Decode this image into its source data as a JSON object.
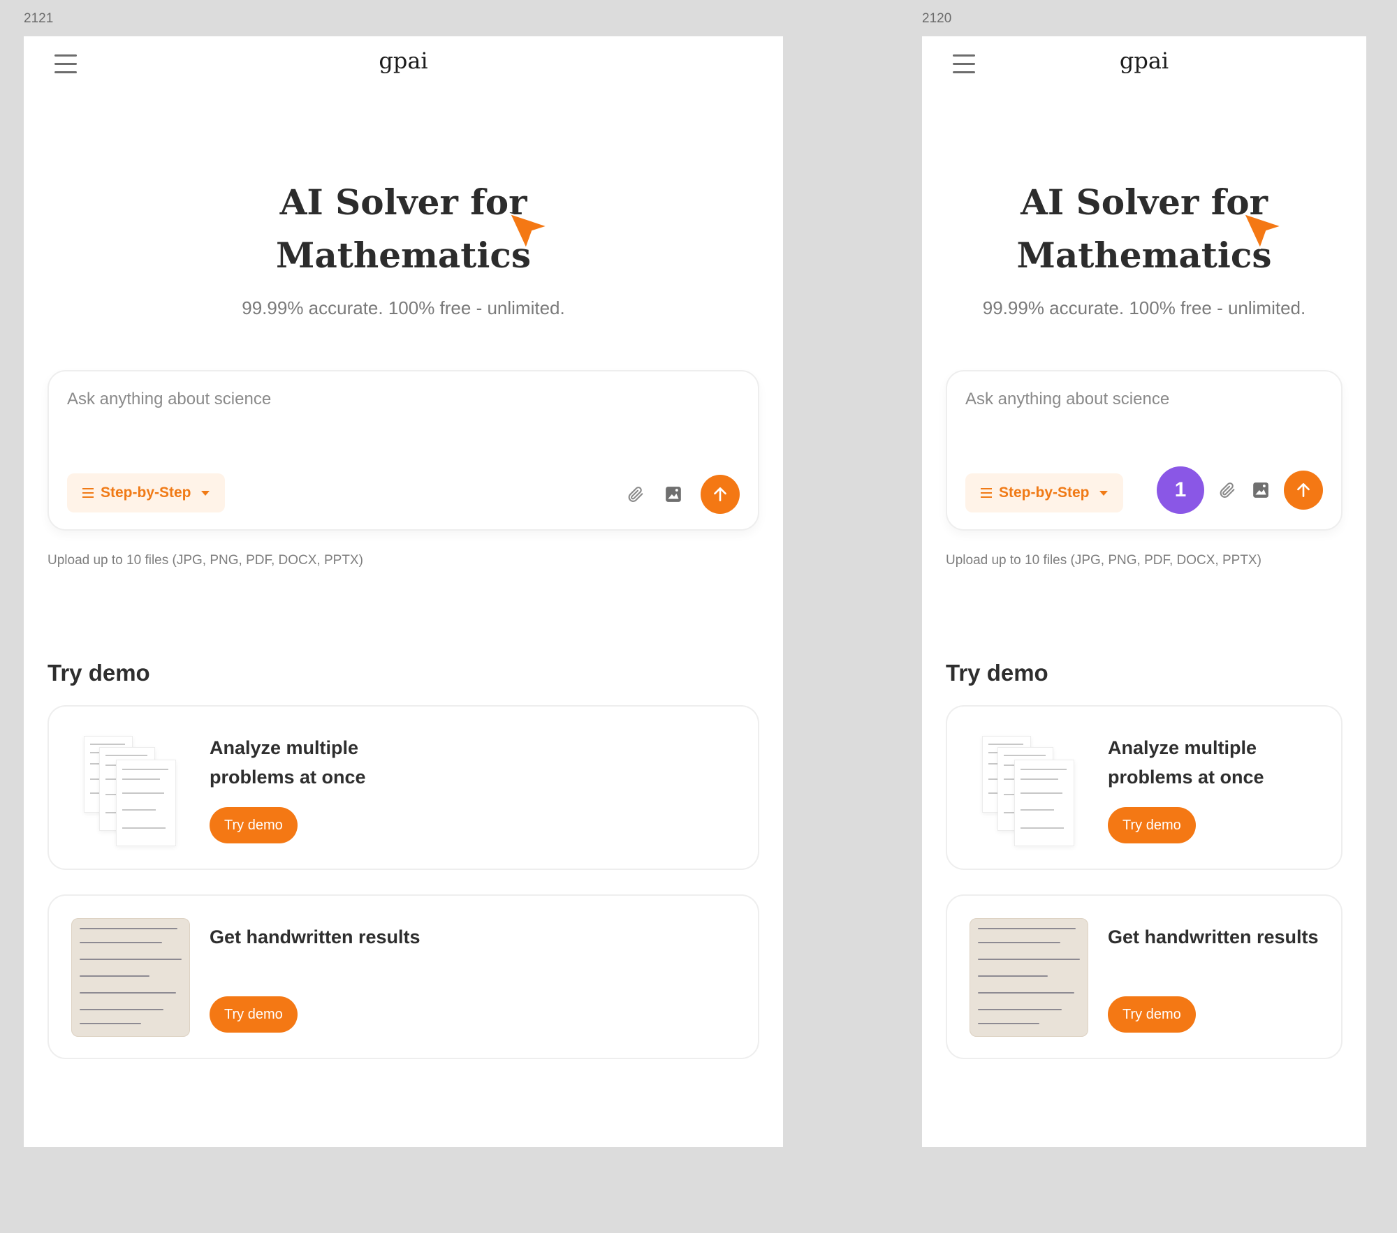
{
  "frames": [
    {
      "label": "2121",
      "logo": "gpai",
      "hero": {
        "line1": "AI Solver for",
        "line2": "Mathematics"
      },
      "subtitle": "99.99%  accurate. 100% free - unlimited.",
      "input": {
        "placeholder": "Ask anything about science"
      },
      "mode": {
        "label": "Step-by-Step"
      },
      "upload_note": "Upload up to 10 files (JPG, PNG, PDF, DOCX, PPTX)",
      "demo_section": "Try demo",
      "cards": [
        {
          "title": "Analyze multiple problems at once",
          "button": "Try demo"
        },
        {
          "title": "Get handwritten results",
          "button": "Try demo"
        }
      ]
    },
    {
      "label": "2120",
      "logo": "gpai",
      "hero": {
        "line1": "AI Solver for",
        "line2": "Mathematics"
      },
      "subtitle": "99.99%  accurate. 100% free - unlimited.",
      "input": {
        "placeholder": "Ask anything about science"
      },
      "mode": {
        "label": "Step-by-Step"
      },
      "badge": "1",
      "upload_note": "Upload up to 10 files (JPG, PNG, PDF, DOCX, PPTX)",
      "demo_section": "Try demo",
      "cards": [
        {
          "title": "Analyze multiple problems at once",
          "button": "Try demo"
        },
        {
          "title": "Get handwritten results",
          "button": "Try demo"
        }
      ]
    }
  ],
  "colors": {
    "accent": "#f47814",
    "accent_soft": "#fff3e8",
    "badge": "#8a57e6",
    "canvas": "#dcdcdc"
  },
  "icons": [
    "menu-icon",
    "cursor-arrow-icon",
    "list-icon",
    "caret-down-icon",
    "paperclip-icon",
    "image-icon",
    "arrow-up-icon"
  ]
}
